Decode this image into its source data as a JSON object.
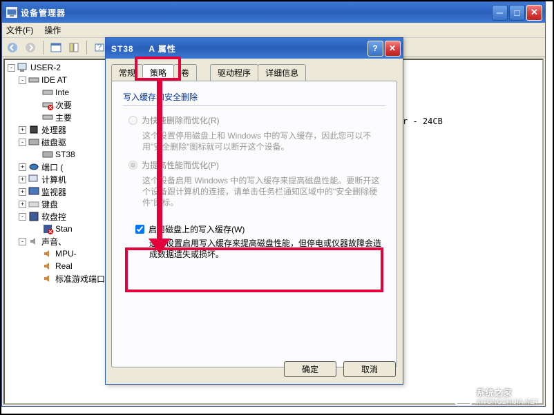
{
  "main": {
    "title": "设备管理器",
    "menu": {
      "file": "文件(F)",
      "action": "操作"
    },
    "tree": {
      "root": "USER-2",
      "ide": "IDE AT",
      "intel": "Inte",
      "sec_ch": "次要",
      "pri_ch": "主要",
      "cpu": "处理器",
      "disk": "磁盘驱",
      "st38": "ST38",
      "port": "端口 (",
      "computer": "计算机",
      "monitor": "监视器",
      "keyboard": "键盘",
      "floppy": "软盘控",
      "stan": "Stan",
      "sound": "声音、",
      "mpu": "MPU-",
      "real": "Real",
      "game": "标准游戏端口"
    },
    "extra_text": "r - 24CB"
  },
  "dialog": {
    "title_pre": "ST38",
    "title_suf": "A 属性",
    "tabs": {
      "general": "常规",
      "policy": "策略",
      "volumes": "卷",
      "driver": "驱动程序",
      "details": "详细信息"
    },
    "group_title": "写入缓存和安全删除",
    "opt1_label": "为快速删除而优化(R)",
    "opt1_desc": "这个设置停用磁盘上和 Windows 中的写入缓存，因此您可以不用\"安全删除\"图标就可以断开这个设备。",
    "opt2_label": "为提高性能而优化(P)",
    "opt2_desc": "这个设备启用 Windows 中的写入缓存来提高磁盘性能。要断开这个设备跟计算机的连接，请单击任务栏通知区域中的\"安全删除硬件\"图标。",
    "chk_label": "启用磁盘上的写入缓存(W)",
    "chk_desc": "这个设置启用写入缓存来提高磁盘性能，但停电或仪器故障会造成数据遗失或损坏。",
    "ok": "确定",
    "cancel": "取消"
  },
  "watermark": {
    "brand": "系统之家",
    "url": "XITONGZHIJIA.NET"
  }
}
